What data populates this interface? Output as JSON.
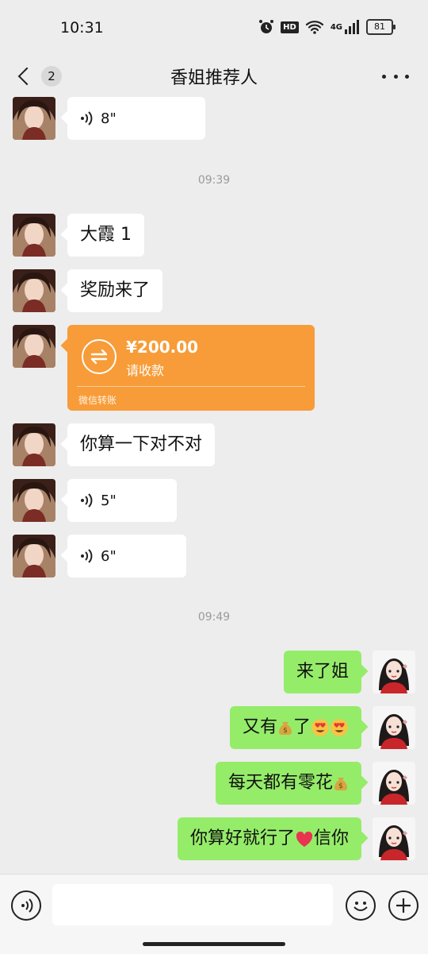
{
  "status": {
    "time": "10:31",
    "hd": "HD",
    "network": "4G",
    "battery": "81"
  },
  "header": {
    "back_count": "2",
    "title": "香姐推荐人"
  },
  "messages": {
    "voice1": "8\"",
    "time1": "09:39",
    "m1": "大霞 1",
    "m2": "奖励来了",
    "transfer": {
      "amount": "¥200.00",
      "action": "请收款",
      "source": "微信转账"
    },
    "m3": "你算一下对不对",
    "voice2": "5\"",
    "voice3": "6\"",
    "time2": "09:49",
    "o1": "来了姐",
    "o2_a": "又有",
    "o2_b": "了",
    "o3": "每天都有零花",
    "o4_a": "你算好就行了",
    "o4_b": "信你"
  },
  "input": {
    "placeholder": ""
  },
  "colors": {
    "outgoing": "#95ec69",
    "transfer": "#f79c38",
    "background": "#ededed"
  }
}
